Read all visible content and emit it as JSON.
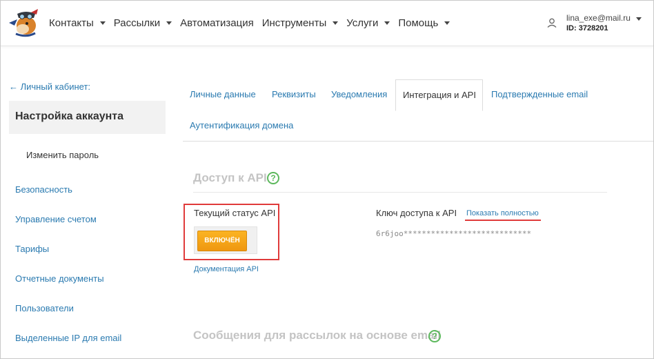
{
  "header": {
    "nav": [
      {
        "label": "Контакты",
        "dropdown": true
      },
      {
        "label": "Рассылки",
        "dropdown": true
      },
      {
        "label": "Автоматизация",
        "dropdown": false
      },
      {
        "label": "Инструменты",
        "dropdown": true
      },
      {
        "label": "Услуги",
        "dropdown": true
      },
      {
        "label": "Помощь",
        "dropdown": true
      }
    ],
    "user": {
      "email": "lina_exe@mail.ru",
      "id": "ID: 3728201"
    }
  },
  "sidebar": {
    "back_link": "← Личный кабинет:",
    "active_section": "Настройка аккаунта",
    "sub_item": "Изменить пароль",
    "items": [
      "Безопасность",
      "Управление счетом",
      "Тарифы",
      "Отчетные документы",
      "Пользователи",
      "Выделенные IP для email"
    ]
  },
  "tabs": {
    "items": [
      "Личные данные",
      "Реквизиты",
      "Уведомления",
      "Интеграция и API",
      "Подтвержденные email",
      "Аутентификация домена"
    ],
    "active_index": 3
  },
  "api_section": {
    "title": "Доступ к API",
    "help_symbol": "?",
    "status_label": "Текущий статус API",
    "status_button": "ВКЛЮЧЁН",
    "docs_link": "Документация API",
    "key_label": "Ключ доступа к API",
    "show_full_link": "Показать полностью",
    "key_value": "6r6joo****************************"
  },
  "email_section": {
    "title": "Сообщения для рассылок на основе email",
    "help_symbol": "?"
  },
  "colors": {
    "link": "#2a7ab0",
    "accent_orange": "#f5a31a",
    "highlight_red": "#e03a3a",
    "help_green": "#5cb85c"
  }
}
